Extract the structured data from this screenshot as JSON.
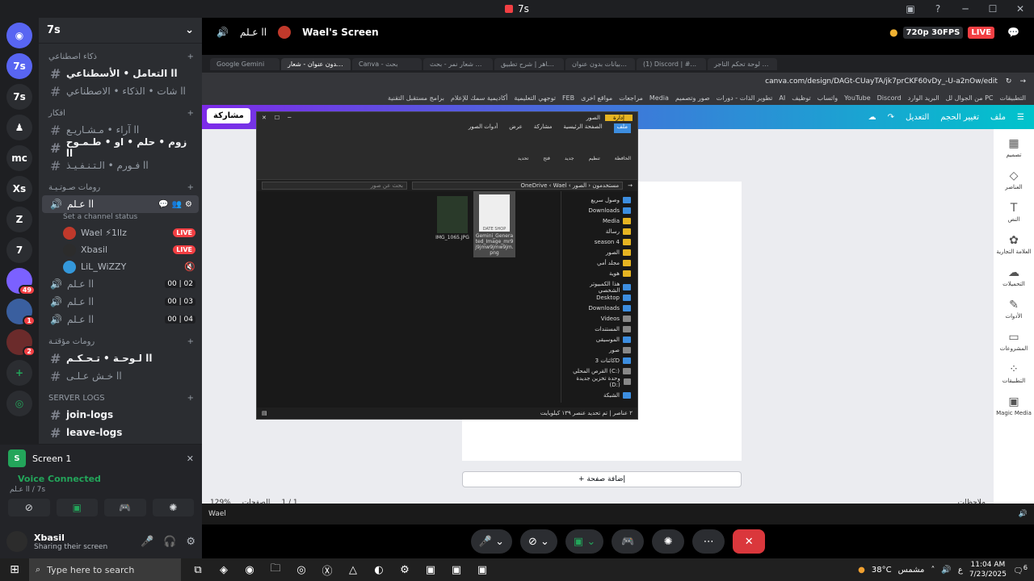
{
  "window": {
    "title": "7s"
  },
  "servers": [
    {
      "label": "7s",
      "badge": ""
    },
    {
      "label": "7s",
      "badge": ""
    },
    {
      "label": "",
      "badge": ""
    },
    {
      "label": "mc",
      "badge": ""
    },
    {
      "label": "Xs",
      "badge": ""
    },
    {
      "label": "Z",
      "badge": ""
    },
    {
      "label": "7",
      "badge": ""
    },
    {
      "label": "",
      "badge": "49"
    },
    {
      "label": "",
      "badge": "1"
    },
    {
      "label": "",
      "badge": "2"
    }
  ],
  "guild": {
    "name": "7s"
  },
  "categories": {
    "c1": "ذكاء اصطناعي",
    "c2": "افكار",
    "c3": "رومات صـوتـيـة",
    "c4": "رومات مؤقتـة",
    "c5": "Server Logs"
  },
  "channels": {
    "ai1": "التعامل • الأسطناعي ll",
    "ai2": "شات • الذكاء • الاصطناعي ll",
    "id1": "آراء • مـشـاريـع ll",
    "id2": "زوم • حلم • او • طـمـوح ll",
    "id3": "فـورم • الـتـنـفـيـذ ll",
    "vc1": "عـلم ll",
    "vc1_status": "Set a channel status",
    "vc2": "عـلم ll",
    "vc2_count": "00 | 02",
    "vc3": "عـلم ll",
    "vc3_count": "00 | 03",
    "vc4": "عـلم ll",
    "vc4_count": "00 | 04",
    "tmp1": "لـوحـة • تـحـكـم ll",
    "tmp2": "خـش عـلـى ll",
    "log1": "join-logs",
    "log2": "leave-logs"
  },
  "voice_users": [
    {
      "name": "Wael ⚡1llz",
      "live": "LIVE"
    },
    {
      "name": "Xbasil",
      "live": "LIVE"
    },
    {
      "name": "LiL_WiZZY",
      "live": ""
    }
  ],
  "voice_panel": {
    "screen_label": "Screen 1",
    "connected": "Voice Connected",
    "channel": "عـلم ll / 7s"
  },
  "user_panel": {
    "name": "Xbasil",
    "status": "Sharing their screen"
  },
  "stage": {
    "channel": "عـلم ll",
    "stream_title": "Wael's Screen",
    "quality": "720p 30FPS",
    "live": "LIVE"
  },
  "browser": {
    "tabs": [
      "مدونة | لوحة تحكم التاجر",
      "(1) Discord | #...",
      "جدول بيانات بدون عنوان",
      "استاذ ماهر | شرح تطبيق",
      "شعار نمر - بحث Google",
      "Canva - بحث",
      "تصميم بدون عنوان - شعار",
      "Google Gemini"
    ],
    "url": "canva.com/design/DAGt-CUayTA/jk7prCKF60vDy_-U-a2nOw/edit",
    "bookmarks": [
      "التطبيقات",
      "من الجوال لل PC",
      "البريد الوارد",
      "Discord",
      "YouTube",
      "واتساب",
      "توظيف",
      "AI",
      "تطوير الذات - دورات",
      "صور وتصميم",
      "Media",
      "مراجعات",
      "مواقع اخرى",
      "FEB",
      "توجهي التعليمية",
      "أكاديمية سمك للإعلام",
      "برامج مستقبل التقنية"
    ]
  },
  "canva": {
    "share": "مشاركة",
    "file": "ملف",
    "resize": "تغيير الحجم",
    "edit": "التعديل",
    "add_page": "+ إضافة صفحة",
    "notes": "ملاحظات",
    "pages": "الصفحات",
    "page_count": "1 / 1",
    "zoom": "129%",
    "rail": [
      "تصميم",
      "العناصر",
      "النص",
      "العلامة التجارية",
      "التحميلات",
      "الأدوات",
      "المشروعات",
      "التطبيقات",
      "Magic Media"
    ]
  },
  "explorer": {
    "title": "الصور",
    "manage_tab": "إدارة",
    "picture_tools": "أدوات الصور",
    "ribbon_tabs": [
      "ملف",
      "الصفحة الرئيسية",
      "مشاركة",
      "عرض"
    ],
    "groups": [
      "الحافظة",
      "تنظيم",
      "جديد",
      "فتح",
      "تحديد"
    ],
    "address": "OneDrive ‹ Wael ‹ مستخدمون ‹ الصور",
    "search_placeholder": "بحث عن صور",
    "files": [
      {
        "name": "IMG_1065.JPG"
      },
      {
        "name": "Gemini_Generated_Image_mr9j9jmw9jmw9jm.png"
      }
    ],
    "thumb_label": "DATE SHOP",
    "nav": [
      "وصول سريع",
      "Downloads",
      "Media",
      "رسالة",
      "season 4",
      "الصور",
      "مجلد أمي",
      "هوية",
      "هذا الكمبيوتر الشخصي",
      "Desktop",
      "Downloads",
      "Videos",
      "المستندات",
      "الموسيقى",
      "صور",
      "كائنات 3D",
      "القرص المحلي (C:)",
      "وحدة تخزين جديدة (D:)",
      "الشبكة"
    ],
    "status": "٢ عناصر | تم تحديد عنصر ١٣٩ كيلوبايت"
  },
  "win_bar": {
    "label": "Wael"
  },
  "taskbar": {
    "search": "Type here to search",
    "weather": "38°C",
    "weather_desc": "مشمس",
    "time": "11:04 AM",
    "date": "7/23/2025",
    "lang": "ع",
    "notif": "6"
  }
}
